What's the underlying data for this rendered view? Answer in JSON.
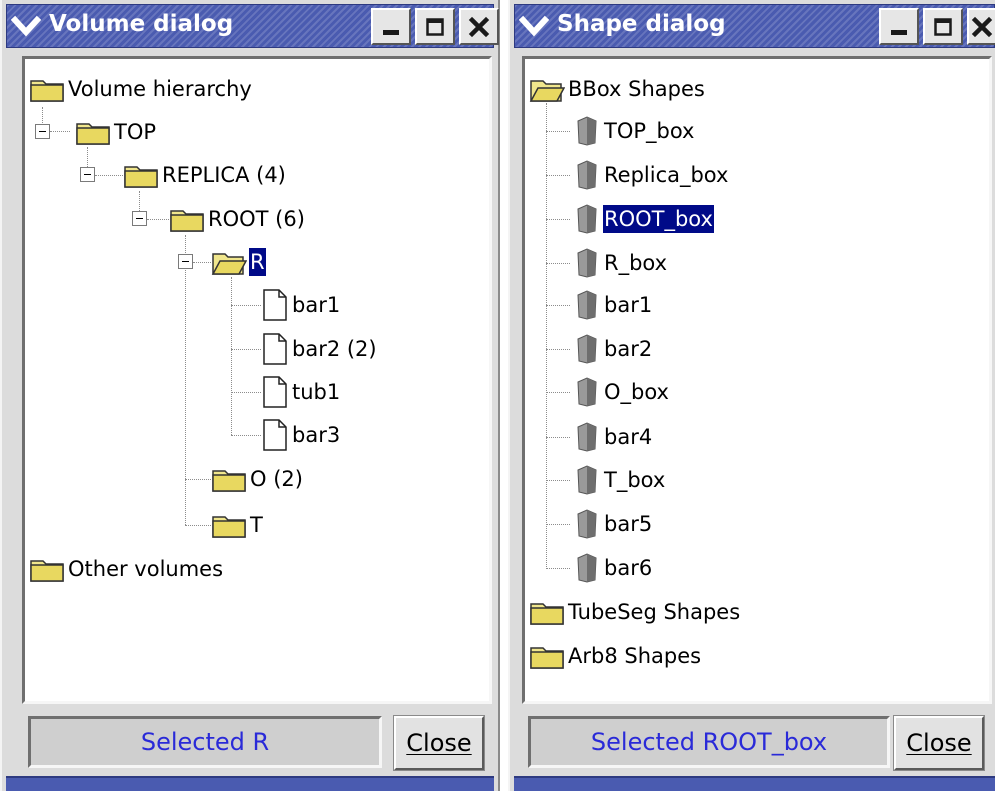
{
  "volume_dialog": {
    "title": "Volume dialog",
    "tree": {
      "root_label": "Volume hierarchy",
      "top": "TOP",
      "replica": "REPLICA (4)",
      "root": "ROOT (6)",
      "r": "R",
      "bar1": "bar1",
      "bar2": "bar2 (2)",
      "tub1": "tub1",
      "bar3": "bar3",
      "o": "O (2)",
      "t": "T",
      "other": "Other volumes"
    },
    "selected_node": "R",
    "status": "Selected R",
    "close_label": "Close"
  },
  "shape_dialog": {
    "title": "Shape dialog",
    "tree": {
      "bbox_group": "BBox Shapes",
      "bbox_items": [
        "TOP_box",
        "Replica_box",
        "ROOT_box",
        "R_box",
        "bar1",
        "bar2",
        "O_box",
        "bar4",
        "T_box",
        "bar5",
        "bar6"
      ],
      "tubeseg_group": "TubeSeg Shapes",
      "arb8_group": "Arb8 Shapes"
    },
    "selected_node": "ROOT_box",
    "status": "Selected ROOT_box",
    "close_label": "Close"
  },
  "colors": {
    "title_bar": "#4a5bb0",
    "selection": "#000a88",
    "status_text": "#2a2ad8",
    "folder": "#f0e68c"
  },
  "icons": {
    "window_menu": "chevron-down-icon",
    "minimize": "minimize-icon",
    "maximize": "maximize-icon",
    "close": "close-icon",
    "folder": "folder-icon",
    "folder_open": "folder-open-icon",
    "file": "file-icon",
    "shape": "shape-icon"
  }
}
